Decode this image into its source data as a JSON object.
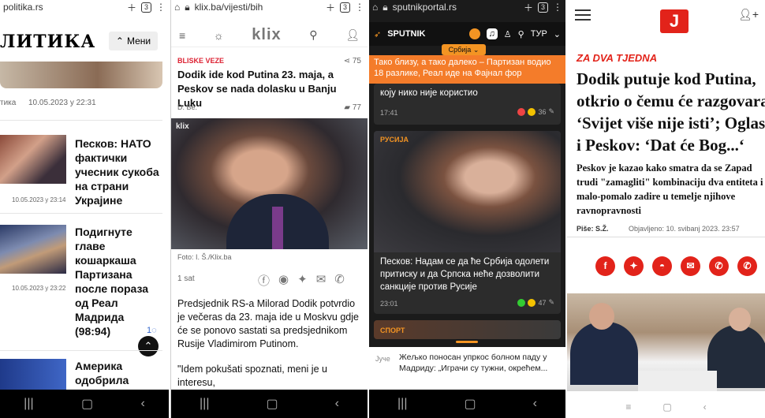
{
  "p1": {
    "url": "politika.rs",
    "tabs": "3",
    "logo": "ЛИТИКА",
    "menu": "Мени",
    "meta_author": "тика",
    "meta_date": "10.05.2023 у 22:31",
    "articles": [
      {
        "title": "Песков: НАТО фактички учесник сукоба на страни Украјине",
        "date": "10.05.2023 у 23:14"
      },
      {
        "title": "Подигнуте главе кошаркаша Партизана после пораза од Реал Мадрида (98:94)",
        "date": "10.05.2023 у 23:22",
        "comments": "1"
      },
      {
        "title": "Америка одобрила"
      }
    ]
  },
  "p2": {
    "url": "klix.ba/vijesti/bih",
    "tabs": "3",
    "logo": "klix",
    "category": "BLISKE VEZE",
    "shares": "75",
    "title": "Dodik ide kod Putina 23. maja, a Peskov se nada dolasku u Banju Luku",
    "author": "D. Be.",
    "comments": "77",
    "watermark": "klix",
    "credit": "Foto: I. Š./Klix.ba",
    "time": "1 sat",
    "body": [
      "Predsjednik RS-a Milorad Dodik potvrdio je večeras da 23. maja ide u Moskvu gdje će se ponovo sastati sa predsjednikom Rusije Vladimirom Putinom.",
      "\"Idem pokušati spoznati, meni je u interesu,"
    ]
  },
  "p3": {
    "url": "sputnikportal.rs",
    "tabs": "3",
    "logo": "SPUTNIK",
    "lang": "ТУР",
    "region": "Србија",
    "banner": "Тако близу, а тако далеко – Партизан водио 18 разлике, Реал иде на Фајнал фор",
    "card1": {
      "title": "коју нико није користио",
      "time": "17:41",
      "reactions": "36"
    },
    "card2": {
      "tag": "РУСИЈА",
      "title": "Песков: Надам се да ће Србија одолети притиску и да Српска неће дозволити санкције против Русије",
      "time": "23:01",
      "reactions": "47"
    },
    "card3": {
      "tag": "СПОРТ"
    },
    "brief": {
      "label": "Јуче",
      "text": "Жељко поносан упркос болном паду у Мадриду: „Играчи су тужни, окрећем..."
    }
  },
  "p4": {
    "logo": "J",
    "kicker": "ZA DVA TJEDNA",
    "headline": [
      "Dodik putuje kod Putina,",
      "otkrio o čemu će razgovarati:",
      "‘Svijet više nije isti’; Oglasio se",
      "i Peskov: ‘Dat će Bog...‘"
    ],
    "lede": [
      "Peskov je kazao kako smatra da se Zapad",
      "trudi \"zamagliti\" kombinaciju dva entiteta i",
      "malo-pomalo zadire u temelje njihove",
      "ravnopravnosti"
    ],
    "byline": "Piše: S.Ž.",
    "published": "Objavljeno: 10. svibanj 2023. 23:57"
  }
}
